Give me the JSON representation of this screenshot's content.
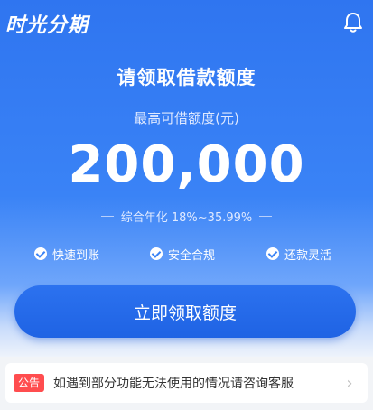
{
  "app": {
    "title": "时光分期"
  },
  "header": {
    "bell_icon": "bell-icon"
  },
  "main": {
    "heading": "请领取借款额度",
    "amount_label": "最高可借额度(元)",
    "amount": "200,000",
    "rate_text": "综合年化 18%~35.99%",
    "features": [
      {
        "label": "快速到账",
        "icon": "check-circle-icon"
      },
      {
        "label": "安全合规",
        "icon": "check-circle-icon"
      },
      {
        "label": "还款灵活",
        "icon": "check-circle-icon"
      }
    ],
    "cta_label": "立即领取额度"
  },
  "notice": {
    "tag": "公告",
    "text": "如遇到部分功能无法使用的情况请咨询客服",
    "arrow_icon": "chevron-right-icon"
  },
  "colors": {
    "primary": "#3a83f6",
    "button": "#1f63e4",
    "notice_tag": "#ff4d4f"
  }
}
